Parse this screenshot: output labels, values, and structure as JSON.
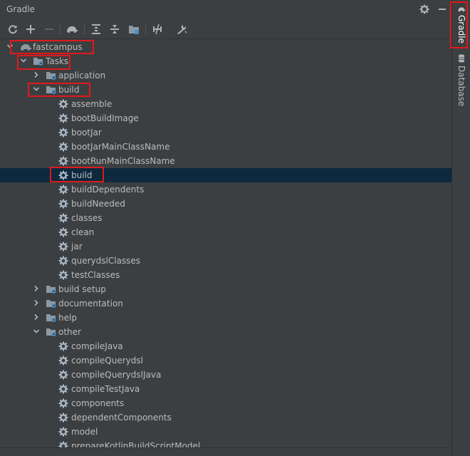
{
  "panel": {
    "title": "Gradle"
  },
  "toolbar": {
    "buttons": [
      {
        "name": "reload-all-icon",
        "glyph": "⟳"
      },
      {
        "name": "add-icon",
        "glyph": "+"
      },
      {
        "name": "remove-icon",
        "glyph": "−"
      },
      {
        "name": "execute-task-icon",
        "glyph": ""
      },
      {
        "name": "expand-all-icon",
        "glyph": ""
      },
      {
        "name": "collapse-all-icon",
        "glyph": ""
      },
      {
        "name": "group-modules-icon",
        "glyph": ""
      },
      {
        "name": "toggle-offline-icon",
        "glyph": ""
      },
      {
        "name": "build-tool-settings-icon",
        "glyph": ""
      }
    ]
  },
  "tree": {
    "root": "fastcampus",
    "tasks": "Tasks",
    "groups": {
      "application": "application",
      "build": "build",
      "build_setup": "build setup",
      "documentation": "documentation",
      "help": "help",
      "other": "other"
    },
    "build_tasks": [
      "assemble",
      "bootBuildImage",
      "bootJar",
      "bootJarMainClassName",
      "bootRunMainClassName",
      "build",
      "buildDependents",
      "buildNeeded",
      "classes",
      "clean",
      "jar",
      "querydslClasses",
      "testClasses"
    ],
    "other_tasks": [
      "compileJava",
      "compileQuerydsl",
      "compileQuerydslJava",
      "compileTestJava",
      "components",
      "dependentComponents",
      "model",
      "prepareKotlinBuildScriptModel"
    ]
  },
  "sidebar": {
    "tabs": [
      "Gradle",
      "Database"
    ]
  },
  "colors": {
    "highlight": "#e0191b",
    "selection": "#0d293e",
    "folder_blue": "#4a90c8"
  }
}
